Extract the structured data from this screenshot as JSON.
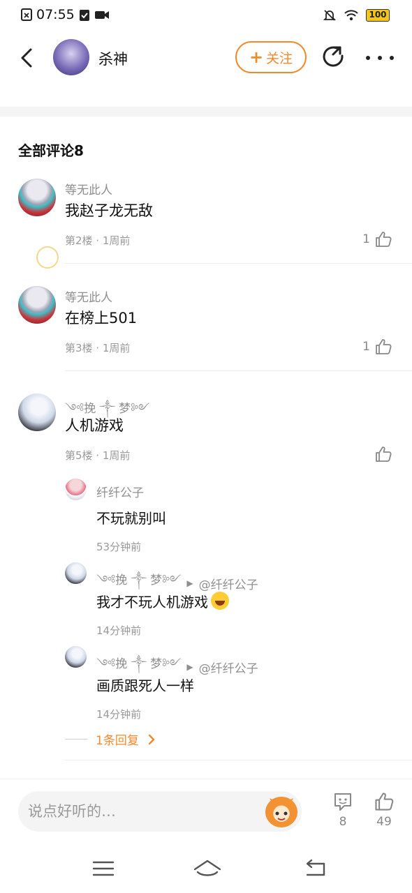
{
  "status_bar": {
    "time": "07:55",
    "battery": "100"
  },
  "header": {
    "username": "杀神",
    "follow_label": "关注",
    "follow_plus": "+"
  },
  "section": {
    "title": "全部评论8"
  },
  "comments": [
    {
      "user": "等无此人",
      "text": "我赵子龙无敌",
      "meta": "第2楼 · 1周前",
      "likes": "1"
    },
    {
      "user": "等无此人",
      "text": "在榜上501",
      "meta": "第3楼 · 1周前",
      "likes": "1"
    },
    {
      "user": "༺挽 ༒ 梦༻",
      "text": "人机游戏",
      "meta": "第5楼 · 1周前",
      "likes": "",
      "replies": [
        {
          "user": "纤纤公子",
          "reply_to": "",
          "text": "不玩就别叫",
          "time": "53分钟前"
        },
        {
          "user": "༺挽 ༒ 梦༻",
          "reply_to": "@纤纤公子",
          "text": "我才不玩人机游戏",
          "time": "14分钟前"
        },
        {
          "user": "༺挽 ༒ 梦༻",
          "reply_to": "@纤纤公子",
          "text": "画质跟死人一样",
          "time": "14分钟前"
        }
      ],
      "more_replies": "1条回复"
    }
  ],
  "bottom_bar": {
    "placeholder": "说点好听的…",
    "comment_count": "8",
    "like_count": "49"
  },
  "colors": {
    "accent": "#f08a2c",
    "text_primary": "#111111",
    "text_secondary": "#8f8f8f"
  }
}
